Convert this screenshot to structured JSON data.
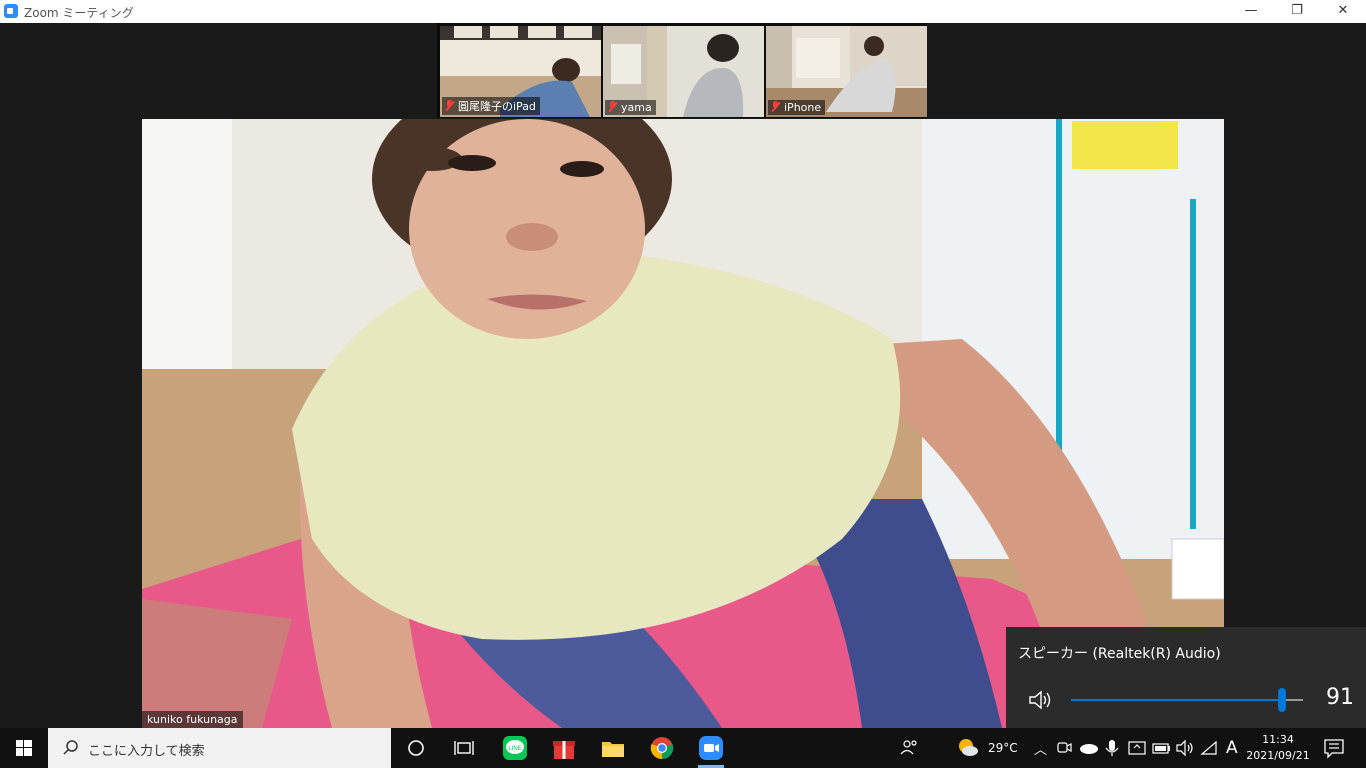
{
  "window": {
    "title": "Zoom ミーティング",
    "minimize_glyph": "—",
    "maximize_glyph": "❐",
    "close_glyph": "✕"
  },
  "participants": [
    {
      "name": "圓尾隆子のiPad",
      "muted": true
    },
    {
      "name": "yama",
      "muted": true
    },
    {
      "name": "iPhone",
      "muted": true
    }
  ],
  "active_speaker": {
    "name": "kuniko fukunaga"
  },
  "volume_flyout": {
    "device": "スピーカー (Realtek(R) Audio)",
    "volume": 91,
    "volume_label": "91",
    "accent": "#0078d7"
  },
  "taskbar": {
    "search_placeholder": "ここに入力して検索",
    "weather_temp": "29°C",
    "ime_indicator": "A",
    "time": "11:34",
    "date": "2021/09/21",
    "apps": [
      "cortana-icon",
      "task-view-icon",
      "line-icon",
      "gift-icon",
      "file-explorer-icon",
      "chrome-icon",
      "zoom-icon"
    ]
  }
}
